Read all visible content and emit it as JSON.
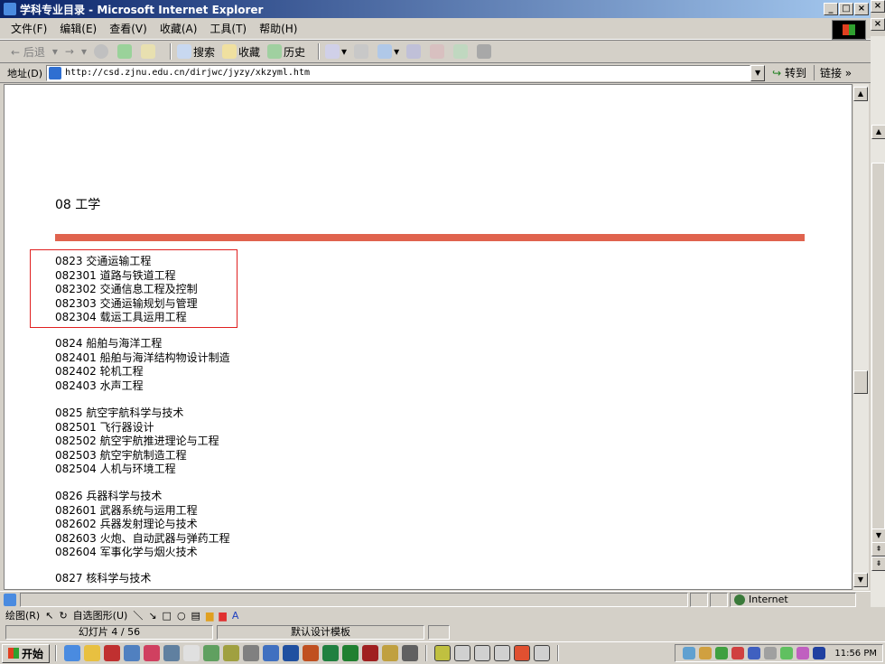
{
  "window": {
    "title": "学科专业目录 - Microsoft Internet Explorer",
    "minimize": "_",
    "maximize": "□",
    "close": "×"
  },
  "menu": [
    "文件(F)",
    "编辑(E)",
    "查看(V)",
    "收藏(A)",
    "工具(T)",
    "帮助(H)"
  ],
  "toolbar": {
    "back": "← 后退",
    "forward": "→",
    "search": "搜索",
    "favorites": "收藏",
    "history": "历史"
  },
  "address": {
    "label": "地址(D)",
    "url": "http://csd.zjnu.edu.cn/dirjwc/jyzy/xkzyml.htm",
    "go": "转到",
    "links": "链接 »"
  },
  "content": {
    "heading": "08 工学",
    "groups": [
      {
        "lines": [
          "0823 交通运输工程",
          "082301 道路与铁道工程",
          "082302 交通信息工程及控制",
          "082303 交通运输规划与管理",
          "082304 载运工具运用工程"
        ],
        "highlighted": true
      },
      {
        "lines": [
          "0824 船舶与海洋工程",
          "082401 船舶与海洋结构物设计制造",
          "082402 轮机工程",
          "082403 水声工程"
        ],
        "highlighted": false
      },
      {
        "lines": [
          "0825 航空宇航科学与技术",
          "082501 飞行器设计",
          "082502 航空宇航推进理论与工程",
          "082503 航空宇航制造工程",
          "082504 人机与环境工程"
        ],
        "highlighted": false
      },
      {
        "lines": [
          "0826 兵器科学与技术",
          "082601 武器系统与运用工程",
          "082602 兵器发射理论与技术",
          "082603 火炮、自动武器与弹药工程",
          "082604 军事化学与烟火技术"
        ],
        "highlighted": false
      },
      {
        "lines": [
          "0827 核科学与技术"
        ],
        "highlighted": false
      }
    ],
    "accent_color": "#e0634e",
    "highlight_color": "#e02020"
  },
  "status": {
    "zone": "Internet"
  },
  "ppt": {
    "draw_menu": "绘图(R)",
    "autoshape_menu": "自选图形(U)",
    "slide": "幻灯片 4 / 56",
    "template": "默认设计模板"
  },
  "taskbar": {
    "start": "开始",
    "time": "11:56 PM"
  }
}
